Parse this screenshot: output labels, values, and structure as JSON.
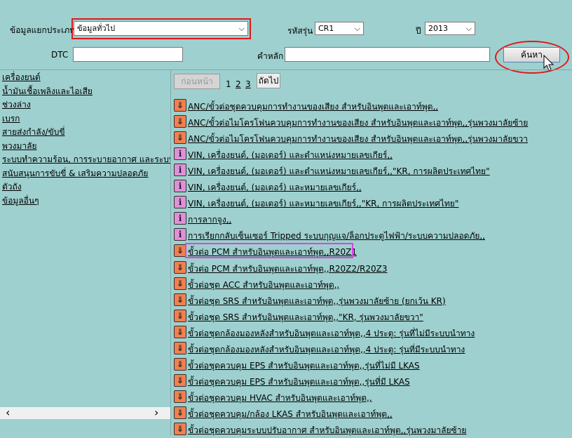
{
  "filters": {
    "category_label": "ข้อมูลแยกประเภท",
    "category_value": "ข้อมูลทั่วไป",
    "model_code_label": "รหัสรุ่น",
    "model_code_value": "CR1",
    "year_label": "ปี",
    "year_value": "2013",
    "dtc_label": "DTC",
    "dtc_value": "",
    "keyword_label": "คำหลัก",
    "keyword_value": "",
    "search_button": "ค้นหา"
  },
  "sidebar": {
    "items": [
      {
        "label": "เครื่องยนต์"
      },
      {
        "label": "น้ำมันเชื้อเพลิงและไอเสีย"
      },
      {
        "label": "ช่วงล่าง"
      },
      {
        "label": "เบรก"
      },
      {
        "label": "สายส่งกำลัง/ขับขี่"
      },
      {
        "label": "พวงมาลัย"
      },
      {
        "label": "ระบบทำความร้อน, การระบายอากาศ และระบบปรับ"
      },
      {
        "label": "สนับสนุนการขับขี่ & เสริมความปลอดภัย"
      },
      {
        "label": "ตัวถัง"
      },
      {
        "label": "ข้อมูลอื่นๆ"
      }
    ],
    "scroll_left": "‹",
    "scroll_right": "›"
  },
  "pager": {
    "prev": "ก่อนหน้า",
    "pages": [
      "1",
      "2",
      "3"
    ],
    "next": "ถัดไป"
  },
  "results": [
    {
      "icon": "warn",
      "text": "ANC/ขั้วต่อชุดควบคุมการทำงานของเสียง สำหรับอินพุตและเอาท์พุต,,"
    },
    {
      "icon": "warn",
      "text": "ANC/ขั้วต่อไมโครโฟนควบคุมการทำงานของเสียง สำหรับอินพุตและเอาท์พุต,,รุ่นพวงมาลัยซ้าย"
    },
    {
      "icon": "warn",
      "text": "ANC/ขั้วต่อไมโครโฟนควบคุมการทำงานของเสียง สำหรับอินพุตและเอาท์พุต,,รุ่นพวงมาลัยขวา"
    },
    {
      "icon": "info",
      "text": "VIN, เครื่องยนต์, (มอเตอร์) และตำแหน่งหมายเลขเกียร์,,"
    },
    {
      "icon": "info",
      "text": "VIN, เครื่องยนต์, (มอเตอร์) และตำแหน่งหมายเลขเกียร์,,\"KR, การผลิตประเทศไทย\""
    },
    {
      "icon": "info",
      "text": "VIN, เครื่องยนต์, (มอเตอร์) และหมายเลขเกียร์,,"
    },
    {
      "icon": "info",
      "text": "VIN, เครื่องยนต์, (มอเตอร์) และหมายเลขเกียร์,,\"KR, การผลิตประเทศไทย\""
    },
    {
      "icon": "info",
      "text": "การลากจูง,,"
    },
    {
      "icon": "info",
      "text": "การเรียกกลับเซ็นเซอร์ Tripped ระบบกุญแจ/ล็อกประตูไฟฟ้า/ระบบความปลอดภัย,,"
    },
    {
      "icon": "warn",
      "text": "ขั้วต่อ PCM สำหรับอินพุตและเอาท์พุต,,R20Z1"
    },
    {
      "icon": "warn",
      "text": "ขั้วต่อ PCM สำหรับอินพุตและเอาท์พุต,,R20Z2/R20Z3"
    },
    {
      "icon": "warn",
      "text": "ขั้วต่อชุด ACC สำหรับอินพุตและเอาท์พุต,,"
    },
    {
      "icon": "warn",
      "text": "ขั้วต่อชุด SRS สำหรับอินพุตและเอาท์พุต,,รุ่นพวงมาลัยซ้าย (ยกเว้น KR)"
    },
    {
      "icon": "warn",
      "text": "ขั้วต่อชุด SRS สำหรับอินพุตและเอาท์พุต,,\"KR, รุ่นพวงมาลัยขวา\""
    },
    {
      "icon": "warn",
      "text": "ขั้วต่อชุดกล้องมองหลังสำหรับอินพุตและเอาท์พุต,,4 ประตู: รุ่นที่ไม่มีระบบนำทาง"
    },
    {
      "icon": "warn",
      "text": "ขั้วต่อชุดกล้องมองหลังสำหรับอินพุตและเอาท์พุต,,4 ประตู: รุ่นที่มีระบบนำทาง"
    },
    {
      "icon": "warn",
      "text": "ขั้วต่อชุดควบคุม EPS สำหรับอินพุตและเอาท์พุต,,รุ่นที่ไม่มี LKAS"
    },
    {
      "icon": "warn",
      "text": "ขั้วต่อชุดควบคุม EPS สำหรับอินพุตและเอาท์พุต,,รุ่นที่มี LKAS"
    },
    {
      "icon": "warn",
      "text": "ขั้วต่อชุดควบคุม HVAC สำหรับอินพุตและเอาท์พุต,,"
    },
    {
      "icon": "warn",
      "text": "ขั้วต่อชุดควบคุม/กล้อง LKAS สำหรับอินพุตและเอาท์พุต,,"
    },
    {
      "icon": "warn",
      "text": "ขั้วต่อชุดควบคุมระบบปรับอากาศ สำหรับอินพุตและเอาท์พุต,,รุ่นพวงมาลัยซ้าย"
    }
  ],
  "icon_glyphs": {
    "warn": "⇓",
    "info": "i"
  }
}
